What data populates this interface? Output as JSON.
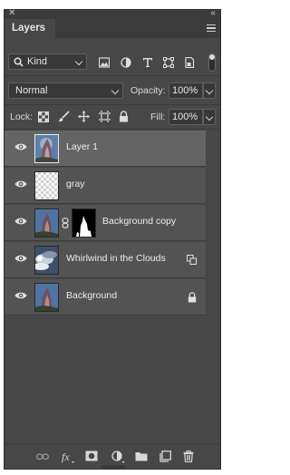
{
  "panel": {
    "tab_label": "Layers"
  },
  "filter": {
    "kind_label": "Kind"
  },
  "blend": {
    "mode": "Normal",
    "opacity_label": "Opacity:",
    "opacity_value": "100%"
  },
  "lock": {
    "label": "Lock:",
    "fill_label": "Fill:",
    "fill_value": "100%"
  },
  "layers": [
    {
      "name": "Layer 1",
      "selected": true
    },
    {
      "name": "gray"
    },
    {
      "name": "Background copy"
    },
    {
      "name": "Whirlwind in the Clouds"
    },
    {
      "name": "Background"
    }
  ],
  "colors": {
    "panel_bg": "#474747",
    "row_bg": "#535353",
    "row_selected": "#646464"
  }
}
